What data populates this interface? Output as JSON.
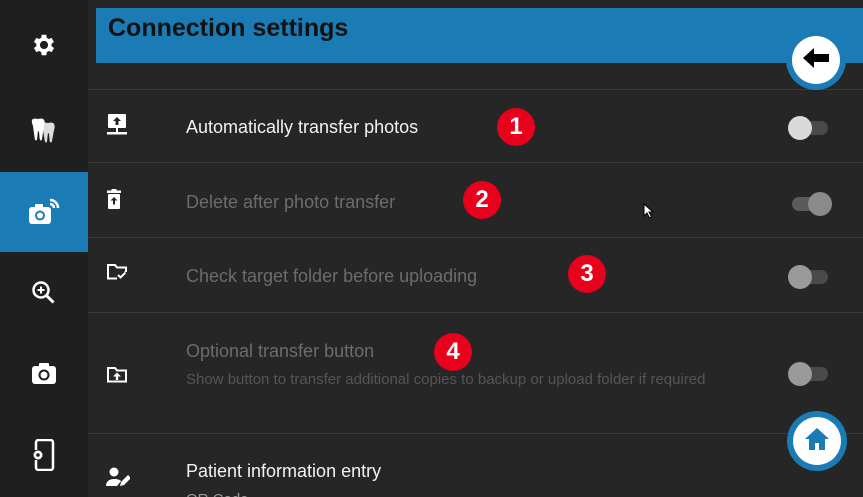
{
  "header": {
    "title": "Connection settings"
  },
  "sidebar": {
    "items": [
      {
        "name": "settings",
        "icon": "gear-icon",
        "active": false
      },
      {
        "name": "teeth",
        "icon": "teeth-icon",
        "active": false
      },
      {
        "name": "camera-wifi",
        "icon": "camera-wireless-icon",
        "active": true
      },
      {
        "name": "zoom",
        "icon": "zoom-in-icon",
        "active": false
      },
      {
        "name": "camera",
        "icon": "camera-icon",
        "active": false
      },
      {
        "name": "device-settings",
        "icon": "device-settings-icon",
        "active": false
      }
    ]
  },
  "settings": [
    {
      "icon": "upload-monitor-icon",
      "label": "Automatically transfer photos",
      "enabled": true,
      "toggle": "off",
      "badge": "1"
    },
    {
      "icon": "trash-upload-icon",
      "label": "Delete after photo transfer",
      "enabled": false,
      "toggle": "on",
      "badge": "2"
    },
    {
      "icon": "folder-check-icon",
      "label": "Check target folder before uploading",
      "enabled": false,
      "toggle": "off",
      "badge": "3"
    },
    {
      "icon": "folder-upload-icon",
      "label": "Optional transfer button",
      "sublabel": "Show button to transfer additional copies to backup or upload folder if required",
      "enabled": false,
      "toggle": "off",
      "badge": "4"
    },
    {
      "icon": "patient-edit-icon",
      "label": "Patient information entry",
      "sublabel": "QR Code",
      "enabled": true
    }
  ],
  "buttons": {
    "back_icon": "arrow-left-icon",
    "home_icon": "home-icon"
  },
  "colors": {
    "accent": "#1a7bb5",
    "badge": "#e8001c",
    "background": "#262626"
  }
}
